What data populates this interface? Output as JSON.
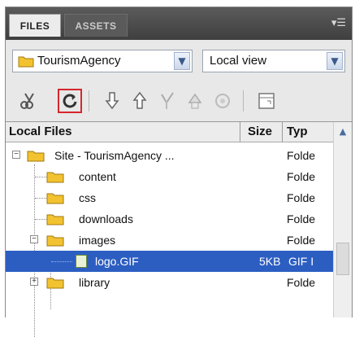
{
  "tabs": [
    "FILES",
    "ASSETS"
  ],
  "panel_menu_icon": "panel-menu-icon",
  "site_select": {
    "value": "TourismAgency",
    "icon": "folder-icon"
  },
  "view_select": {
    "value": "Local view"
  },
  "toolbar": {
    "buttons": [
      "connect-icon",
      "refresh-icon",
      "get-files-icon",
      "put-files-icon",
      "check-out-icon",
      "check-in-icon",
      "synchronize-icon",
      "expand-icon"
    ],
    "highlight_color": "#d6262c"
  },
  "file_list": {
    "columns": {
      "name": "Local Files",
      "size": "Size",
      "type": "Typ"
    },
    "rows": [
      {
        "name": "Site - TourismAgency ...",
        "size": "",
        "type": "Folde",
        "kind": "folder",
        "expander": "−"
      },
      {
        "name": "content",
        "size": "",
        "type": "Folde",
        "kind": "folder"
      },
      {
        "name": "css",
        "size": "",
        "type": "Folde",
        "kind": "folder"
      },
      {
        "name": "downloads",
        "size": "",
        "type": "Folde",
        "kind": "folder"
      },
      {
        "name": "images",
        "size": "",
        "type": "Folde",
        "kind": "folder",
        "expander": "−"
      },
      {
        "name": "logo.GIF",
        "size": "5KB",
        "type": "GIF I",
        "kind": "gif",
        "selected": true
      },
      {
        "name": "library",
        "size": "",
        "type": "Folde",
        "kind": "folder",
        "expander": "+"
      }
    ]
  },
  "colors": {
    "folder": "#f2c230",
    "selection": "#2c5ec2"
  }
}
